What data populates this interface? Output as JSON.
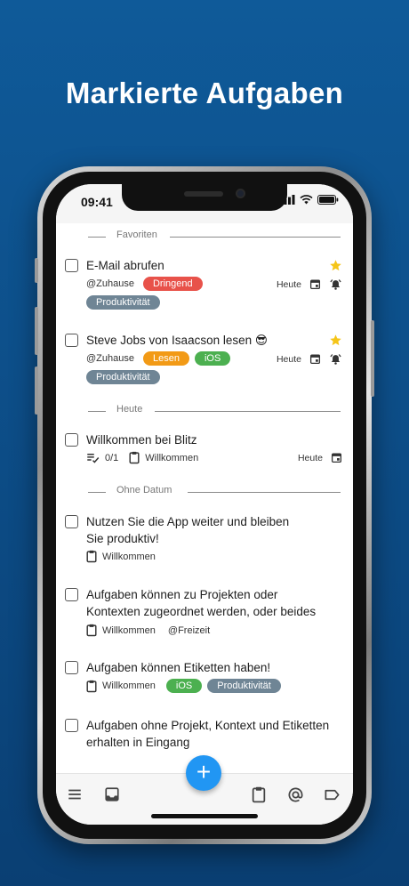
{
  "headline": "Markierte Aufgaben",
  "status": {
    "time": "09:41"
  },
  "sections": [
    {
      "label": "Favoriten"
    },
    {
      "label": "Heute"
    },
    {
      "label": "Ohne Datum"
    }
  ],
  "tasks": [
    {
      "title": "E-Mail abrufen",
      "context": "@Zuhause",
      "tags": [
        {
          "label": "Dringend",
          "color": "#e8524a"
        },
        {
          "label": "Produktivität",
          "color": "#6f8595"
        }
      ],
      "due": "Heute",
      "starred": true,
      "alarm": true
    },
    {
      "title": "Steve Jobs von Isaacson lesen 😎",
      "context": "@Zuhause",
      "tags": [
        {
          "label": "Lesen",
          "color": "#f29a16"
        },
        {
          "label": "iOS",
          "color": "#4cb050"
        },
        {
          "label": "Produktivität",
          "color": "#6f8595"
        }
      ],
      "due": "Heute",
      "starred": true,
      "alarm": true
    },
    {
      "title": "Willkommen bei Blitz",
      "checklist": "0/1",
      "project": "Willkommen",
      "due": "Heute"
    },
    {
      "title_line1": "Nutzen Sie die App weiter und bleiben",
      "title_line2": "Sie produktiv!",
      "project": "Willkommen"
    },
    {
      "title_line1": "Aufgaben können zu Projekten oder",
      "title_line2": "Kontexten zugeordnet werden, oder beides",
      "project": "Willkommen",
      "context": "@Freizeit"
    },
    {
      "title": "Aufgaben können Etiketten haben!",
      "project": "Willkommen",
      "tags": [
        {
          "label": "iOS",
          "color": "#4cb050"
        },
        {
          "label": "Produktivität",
          "color": "#6f8595"
        }
      ]
    },
    {
      "title_line1": "Aufgaben ohne Projekt, Kontext und Etiketten",
      "title_line2": "erhalten in Eingang"
    }
  ],
  "fab": {
    "symbol": "+"
  },
  "colors": {
    "accent": "#2196f3",
    "background": "#0f5a99",
    "star": "#f5c518"
  }
}
